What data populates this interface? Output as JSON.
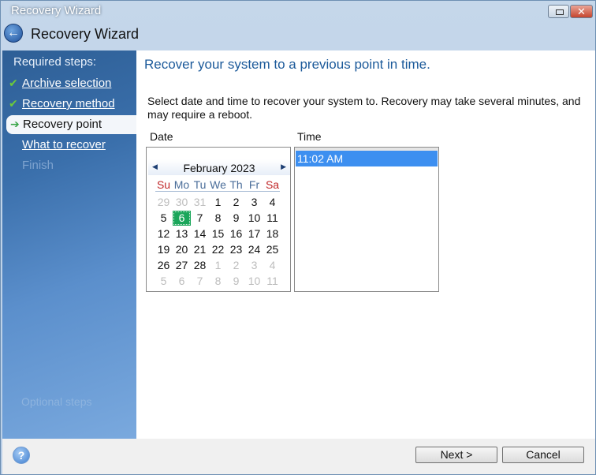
{
  "window": {
    "title": "Recovery Wizard",
    "header": "Recovery Wizard"
  },
  "sidebar": {
    "required_label": "Required steps:",
    "optional_label": "Optional steps",
    "steps": [
      {
        "label": "Archive selection",
        "state": "done"
      },
      {
        "label": "Recovery method",
        "state": "done"
      },
      {
        "label": "Recovery point",
        "state": "active"
      },
      {
        "label": "What to recover",
        "state": "pending"
      },
      {
        "label": "Finish",
        "state": "disabled"
      }
    ]
  },
  "main": {
    "title": "Recover your system to a previous point in time.",
    "description": "Select date and time to recover your system to. Recovery may take several minutes, and may require a reboot.",
    "date_label": "Date",
    "time_label": "Time",
    "calendar": {
      "month": "February 2023",
      "selected": "6",
      "dows": [
        "Su",
        "Mo",
        "Tu",
        "We",
        "Th",
        "Fr",
        "Sa"
      ],
      "weeks": [
        [
          [
            "29",
            1
          ],
          [
            "30",
            1
          ],
          [
            "31",
            1
          ],
          [
            "1",
            0
          ],
          [
            "2",
            0
          ],
          [
            "3",
            0
          ],
          [
            "4",
            0
          ]
        ],
        [
          [
            "5",
            0
          ],
          [
            "6",
            0
          ],
          [
            "7",
            0
          ],
          [
            "8",
            0
          ],
          [
            "9",
            0
          ],
          [
            "10",
            0
          ],
          [
            "11",
            0
          ]
        ],
        [
          [
            "12",
            0
          ],
          [
            "13",
            0
          ],
          [
            "14",
            0
          ],
          [
            "15",
            0
          ],
          [
            "16",
            0
          ],
          [
            "17",
            0
          ],
          [
            "18",
            0
          ]
        ],
        [
          [
            "19",
            0
          ],
          [
            "20",
            0
          ],
          [
            "21",
            0
          ],
          [
            "22",
            0
          ],
          [
            "23",
            0
          ],
          [
            "24",
            0
          ],
          [
            "25",
            0
          ]
        ],
        [
          [
            "26",
            0
          ],
          [
            "27",
            0
          ],
          [
            "28",
            0
          ],
          [
            "1",
            1
          ],
          [
            "2",
            1
          ],
          [
            "3",
            1
          ],
          [
            "4",
            1
          ]
        ],
        [
          [
            "5",
            1
          ],
          [
            "6",
            1
          ],
          [
            "7",
            1
          ],
          [
            "8",
            1
          ],
          [
            "9",
            1
          ],
          [
            "10",
            1
          ],
          [
            "11",
            1
          ]
        ]
      ]
    },
    "times": [
      "11:02 AM"
    ]
  },
  "footer": {
    "next": "Next >",
    "cancel": "Cancel"
  },
  "colors": {
    "accent": "#1c5a9a",
    "selected_day": "#1aa65a",
    "selected_time": "#3d8ff0"
  }
}
